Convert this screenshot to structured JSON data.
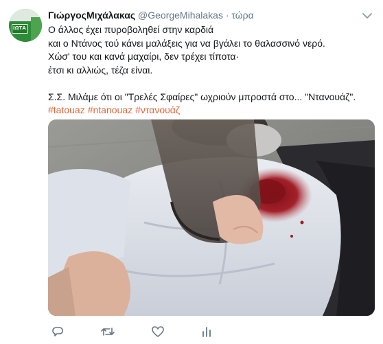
{
  "tweet": {
    "display_name": "ΓιώργοςΜιχάλακας",
    "handle": "@GeorgeMihalakas",
    "separator": "·",
    "time": "τώρα",
    "avatar_sign_text": "ΙΩΤΑ",
    "lines": [
      "Ο άλλος έχει πυροβοληθεί στην καρδιά",
      "και ο Ντάνος τού κάνει μαλάξεις για να βγάλει το θαλασσινό νερό.",
      "Χώσ' του και κανά μαχαίρι, δεν τρέχει τίποτα·",
      "έτσι κι αλλιώς, τέζα είναι."
    ],
    "footnote": "Σ.Σ. Μιλάμε ότι οι \"Τρελές Σφαίρες\" ωχριούν μπροστά στο... \"Ντανουάζ\".",
    "hashtags": [
      "#tatouaz",
      "#ntanouaz",
      "#ντανουάζ"
    ]
  },
  "icons": {
    "caret": "chevron-down-icon",
    "reply": "reply-icon",
    "retweet": "retweet-icon",
    "like": "heart-icon",
    "analytics": "analytics-icon"
  },
  "colors": {
    "hashtag": "#e0683b",
    "secondary_text": "#657786",
    "blood": "#9b1b22"
  }
}
